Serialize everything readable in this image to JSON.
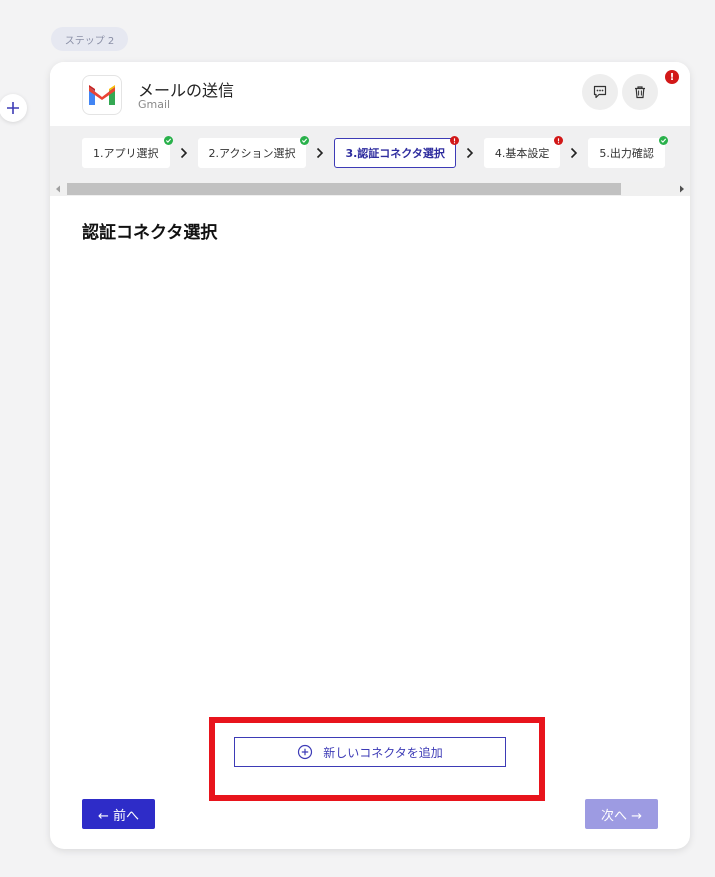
{
  "step_badge": "ステップ 2",
  "header": {
    "title": "メールの送信",
    "subtitle": "Gmail",
    "app_logo": "gmail-logo"
  },
  "tabs": [
    {
      "label": "1.アプリ選択",
      "status": "ok",
      "active": false
    },
    {
      "label": "2.アクション選択",
      "status": "ok",
      "active": false
    },
    {
      "label": "3.認証コネクタ選択",
      "status": "error",
      "active": true
    },
    {
      "label": "4.基本設定",
      "status": "error",
      "active": false
    },
    {
      "label": "5.出力確認",
      "status": "ok",
      "active": false
    }
  ],
  "section_title": "認証コネクタ選択",
  "add_connector_label": "新しいコネクタを追加",
  "nav": {
    "prev_label": "← 前へ",
    "next_label": "次へ →"
  },
  "colors": {
    "accent": "#3d3bb6",
    "prev_button": "#2e2cc8",
    "next_button_disabled": "#9d9be2",
    "error": "#d21818",
    "success": "#29b14b",
    "highlight": "#e8141c"
  },
  "icons": {
    "comment": "comment-icon",
    "delete": "trash-icon",
    "add_step": "plus-icon",
    "error_badge": "exclamation-icon"
  }
}
